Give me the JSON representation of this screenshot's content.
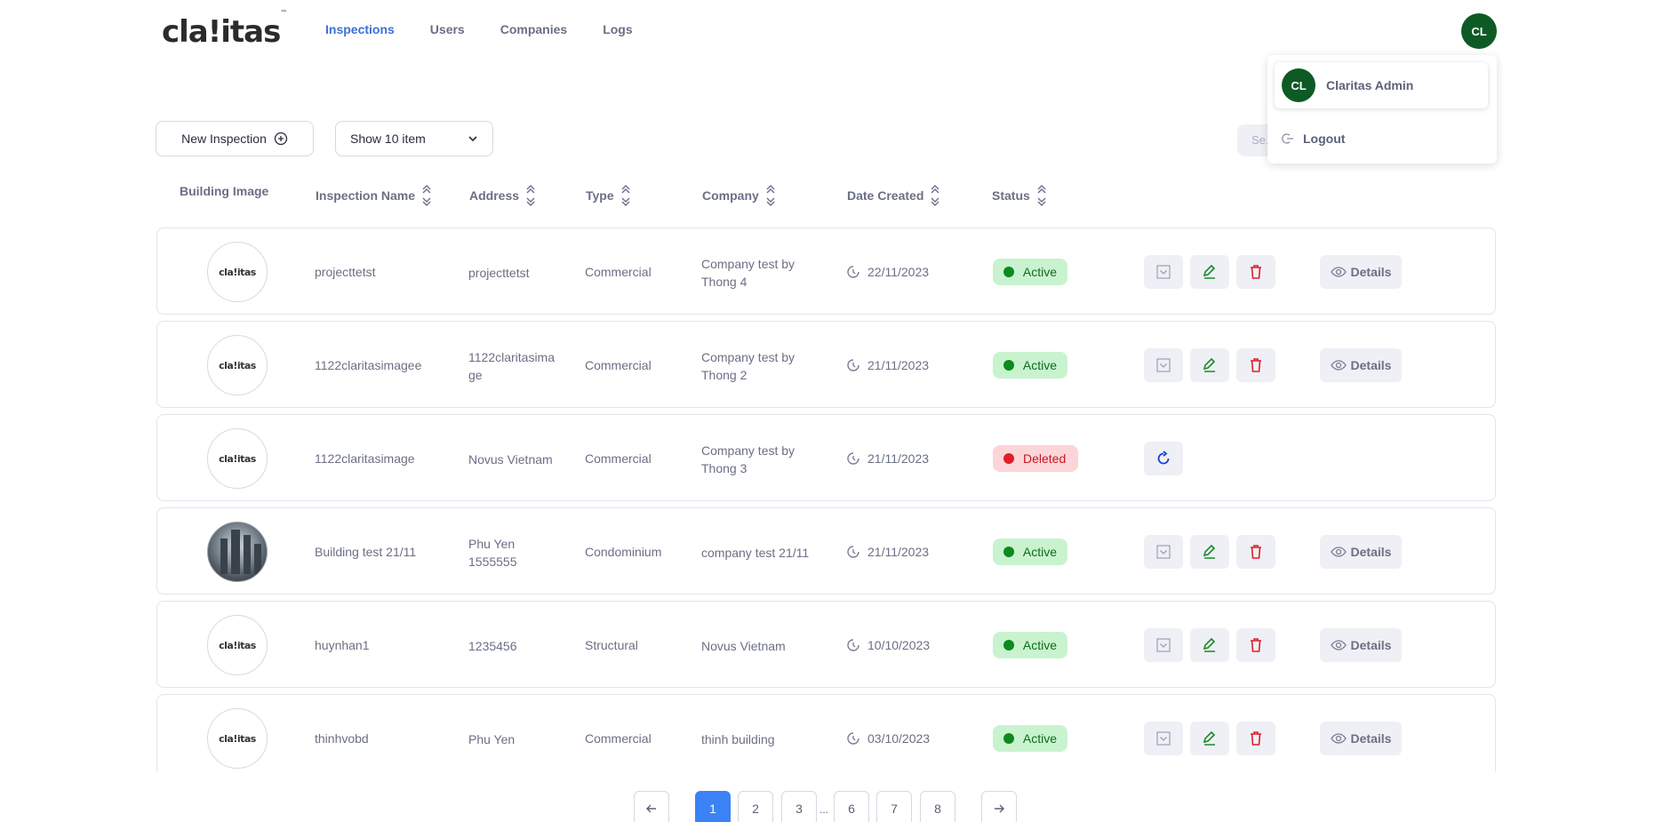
{
  "brand": {
    "logo_text": "cla!itas",
    "trademark": "™"
  },
  "nav": {
    "items": [
      {
        "label": "Inspections",
        "active": true
      },
      {
        "label": "Users",
        "active": false
      },
      {
        "label": "Companies",
        "active": false
      },
      {
        "label": "Logs",
        "active": false
      }
    ]
  },
  "user": {
    "initials": "CL",
    "name": "Claritas Admin",
    "logout_label": "Logout"
  },
  "toolbar": {
    "new_label": "New Inspection",
    "show_label": "Show 10 item",
    "search_placeholder": "Se..."
  },
  "columns": [
    "Building Image",
    "Inspection Name",
    "Address",
    "Type",
    "Company",
    "Date Created",
    "Status"
  ],
  "thumb_logo_text": "cla!itas",
  "rows": [
    {
      "image": "logo",
      "name": "projecttetst",
      "address": [
        "projecttetst"
      ],
      "type": "Commercial",
      "company": [
        "Company test by",
        "Thong 4"
      ],
      "date": "22/11/2023",
      "status": "Active"
    },
    {
      "image": "logo",
      "name": "1122claritasimagee",
      "address": [
        "1122claritasima",
        "ge"
      ],
      "type": "Commercial",
      "company": [
        "Company test by",
        "Thong 2"
      ],
      "date": "21/11/2023",
      "status": "Active"
    },
    {
      "image": "logo",
      "name": "1122claritasimage",
      "address": [
        "Novus Vietnam"
      ],
      "type": "Commercial",
      "company": [
        "Company test by",
        "Thong 3"
      ],
      "date": "21/11/2023",
      "status": "Deleted"
    },
    {
      "image": "photo",
      "name": "Building test 21/11",
      "address": [
        "Phu Yen",
        "1555555"
      ],
      "type": "Condominium",
      "company": [
        "company test 21/11"
      ],
      "date": "21/11/2023",
      "status": "Active"
    },
    {
      "image": "logo",
      "name": "huynhan1",
      "address": [
        "1235456"
      ],
      "type": "Structural",
      "company": [
        "Novus Vietnam"
      ],
      "date": "10/10/2023",
      "status": "Active"
    },
    {
      "image": "logo",
      "name": "thinhvobd",
      "address": [
        "Phu Yen"
      ],
      "type": "Commercial",
      "company": [
        "thinh building"
      ],
      "date": "03/10/2023",
      "status": "Active"
    }
  ],
  "details_label": "Details",
  "pagination": {
    "pages": [
      "1",
      "2",
      "3",
      "6",
      "7",
      "8"
    ],
    "current": "1",
    "ellipsis": "..."
  },
  "colors": {
    "accent": "#3b82f6",
    "avatar": "#0e5a25",
    "active_bg": "#c9f3cf",
    "deleted_bg": "#fcd5d8",
    "edit": "#1a8a2a",
    "delete": "#e11d2a"
  }
}
